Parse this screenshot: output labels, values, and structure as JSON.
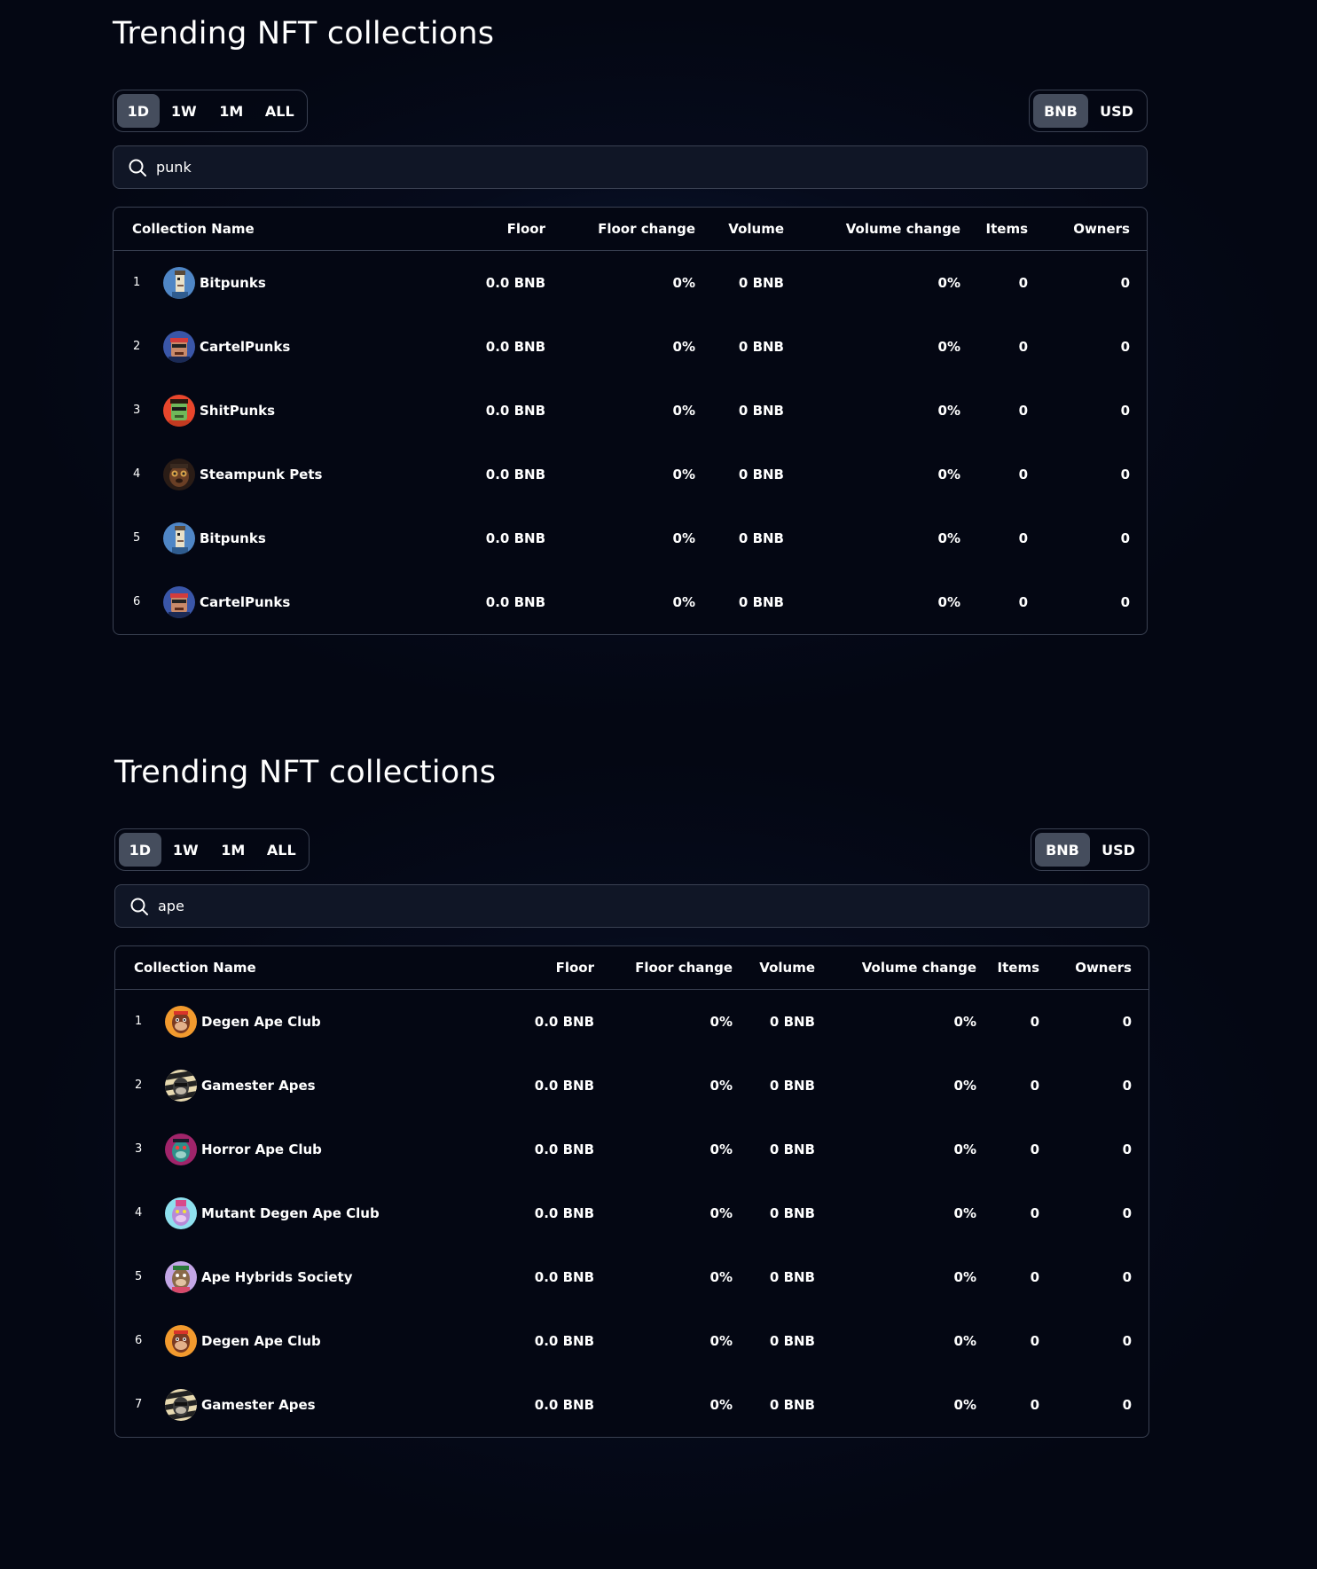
{
  "sections": [
    {
      "title": "Trending NFT collections",
      "time_filters": [
        {
          "label": "1D",
          "active": true
        },
        {
          "label": "1W",
          "active": false
        },
        {
          "label": "1M",
          "active": false
        },
        {
          "label": "ALL",
          "active": false
        }
      ],
      "currency_filters": [
        {
          "label": "BNB",
          "active": true
        },
        {
          "label": "USD",
          "active": false
        }
      ],
      "search": {
        "value": "punk",
        "icon": "search-icon"
      },
      "columns": {
        "name": "Collection Name",
        "floor": "Floor",
        "floor_change": "Floor change",
        "volume": "Volume",
        "volume_change": "Volume change",
        "items": "Items",
        "owners": "Owners"
      },
      "rows": [
        {
          "rank": "1",
          "name": "Bitpunks",
          "avatar": "bitpunks",
          "floor": "0.0 BNB",
          "floor_change": "0%",
          "volume": "0 BNB",
          "volume_change": "0%",
          "items": "0",
          "owners": "0"
        },
        {
          "rank": "2",
          "name": "CartelPunks",
          "avatar": "cartelpunks",
          "floor": "0.0 BNB",
          "floor_change": "0%",
          "volume": "0 BNB",
          "volume_change": "0%",
          "items": "0",
          "owners": "0"
        },
        {
          "rank": "3",
          "name": "ShitPunks",
          "avatar": "shitpunks",
          "floor": "0.0 BNB",
          "floor_change": "0%",
          "volume": "0 BNB",
          "volume_change": "0%",
          "items": "0",
          "owners": "0"
        },
        {
          "rank": "4",
          "name": "Steampunk Pets",
          "avatar": "steampunk",
          "floor": "0.0 BNB",
          "floor_change": "0%",
          "volume": "0 BNB",
          "volume_change": "0%",
          "items": "0",
          "owners": "0"
        },
        {
          "rank": "5",
          "name": "Bitpunks",
          "avatar": "bitpunks",
          "floor": "0.0 BNB",
          "floor_change": "0%",
          "volume": "0 BNB",
          "volume_change": "0%",
          "items": "0",
          "owners": "0"
        },
        {
          "rank": "6",
          "name": "CartelPunks",
          "avatar": "cartelpunks",
          "floor": "0.0 BNB",
          "floor_change": "0%",
          "volume": "0 BNB",
          "volume_change": "0%",
          "items": "0",
          "owners": "0"
        }
      ]
    },
    {
      "title": "Trending NFT collections",
      "time_filters": [
        {
          "label": "1D",
          "active": true
        },
        {
          "label": "1W",
          "active": false
        },
        {
          "label": "1M",
          "active": false
        },
        {
          "label": "ALL",
          "active": false
        }
      ],
      "currency_filters": [
        {
          "label": "BNB",
          "active": true
        },
        {
          "label": "USD",
          "active": false
        }
      ],
      "search": {
        "value": "ape",
        "icon": "search-icon"
      },
      "columns": {
        "name": "Collection Name",
        "floor": "Floor",
        "floor_change": "Floor change",
        "volume": "Volume",
        "volume_change": "Volume change",
        "items": "Items",
        "owners": "Owners"
      },
      "rows": [
        {
          "rank": "1",
          "name": "Degen Ape Club",
          "avatar": "degen",
          "floor": "0.0 BNB",
          "floor_change": "0%",
          "volume": "0 BNB",
          "volume_change": "0%",
          "items": "0",
          "owners": "0"
        },
        {
          "rank": "2",
          "name": "Gamester Apes",
          "avatar": "gamester",
          "floor": "0.0 BNB",
          "floor_change": "0%",
          "volume": "0 BNB",
          "volume_change": "0%",
          "items": "0",
          "owners": "0"
        },
        {
          "rank": "3",
          "name": "Horror Ape Club",
          "avatar": "horror",
          "floor": "0.0 BNB",
          "floor_change": "0%",
          "volume": "0 BNB",
          "volume_change": "0%",
          "items": "0",
          "owners": "0"
        },
        {
          "rank": "4",
          "name": "Mutant Degen Ape Club",
          "avatar": "mutant",
          "floor": "0.0 BNB",
          "floor_change": "0%",
          "volume": "0 BNB",
          "volume_change": "0%",
          "items": "0",
          "owners": "0"
        },
        {
          "rank": "5",
          "name": "Ape Hybrids Society",
          "avatar": "hybrids",
          "floor": "0.0 BNB",
          "floor_change": "0%",
          "volume": "0 BNB",
          "volume_change": "0%",
          "items": "0",
          "owners": "0"
        },
        {
          "rank": "6",
          "name": "Degen Ape Club",
          "avatar": "degen",
          "floor": "0.0 BNB",
          "floor_change": "0%",
          "volume": "0 BNB",
          "volume_change": "0%",
          "items": "0",
          "owners": "0"
        },
        {
          "rank": "7",
          "name": "Gamester Apes",
          "avatar": "gamester",
          "floor": "0.0 BNB",
          "floor_change": "0%",
          "volume": "0 BNB",
          "volume_change": "0%",
          "items": "0",
          "owners": "0"
        }
      ]
    }
  ],
  "colors": {
    "background": "#040713",
    "border": "#3a4152",
    "active_pill": "#454d5d",
    "search_bg": "#101626",
    "text": "#ffffff"
  }
}
